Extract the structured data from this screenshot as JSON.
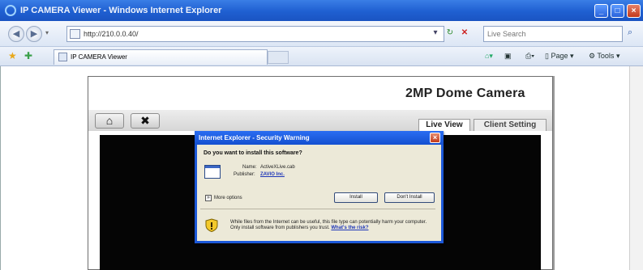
{
  "window": {
    "title": "IP CAMERA Viewer - Windows Internet Explorer"
  },
  "address": {
    "url": "http://210.0.0.40/"
  },
  "search": {
    "placeholder": "Live Search"
  },
  "tabs": [
    {
      "label": "IP CAMERA Viewer"
    }
  ],
  "toolbar": {
    "page_label": "Page",
    "tools_label": "Tools"
  },
  "camera": {
    "title": "2MP Dome Camera",
    "tabs": [
      {
        "label": "Live View"
      },
      {
        "label": "Client Setting"
      }
    ]
  },
  "dialog": {
    "title": "Internet Explorer - Security Warning",
    "question": "Do you want to install this software?",
    "name_label": "Name:",
    "name_value": "ActiveXLive.cab",
    "publisher_label": "Publisher:",
    "publisher_value": "ZAVIO Inc.",
    "more_options": "More options",
    "install_button": "Install",
    "dont_install_button": "Don't Install",
    "note": "While files from the Internet can be useful, this file type can potentially harm your computer. Only install software from publishers you trust.",
    "note_link": "What's the risk?"
  },
  "colors": {
    "ie_blue": "#1f5fd1",
    "dialog_bg": "#ece9d8",
    "video_bg": "#050505"
  }
}
